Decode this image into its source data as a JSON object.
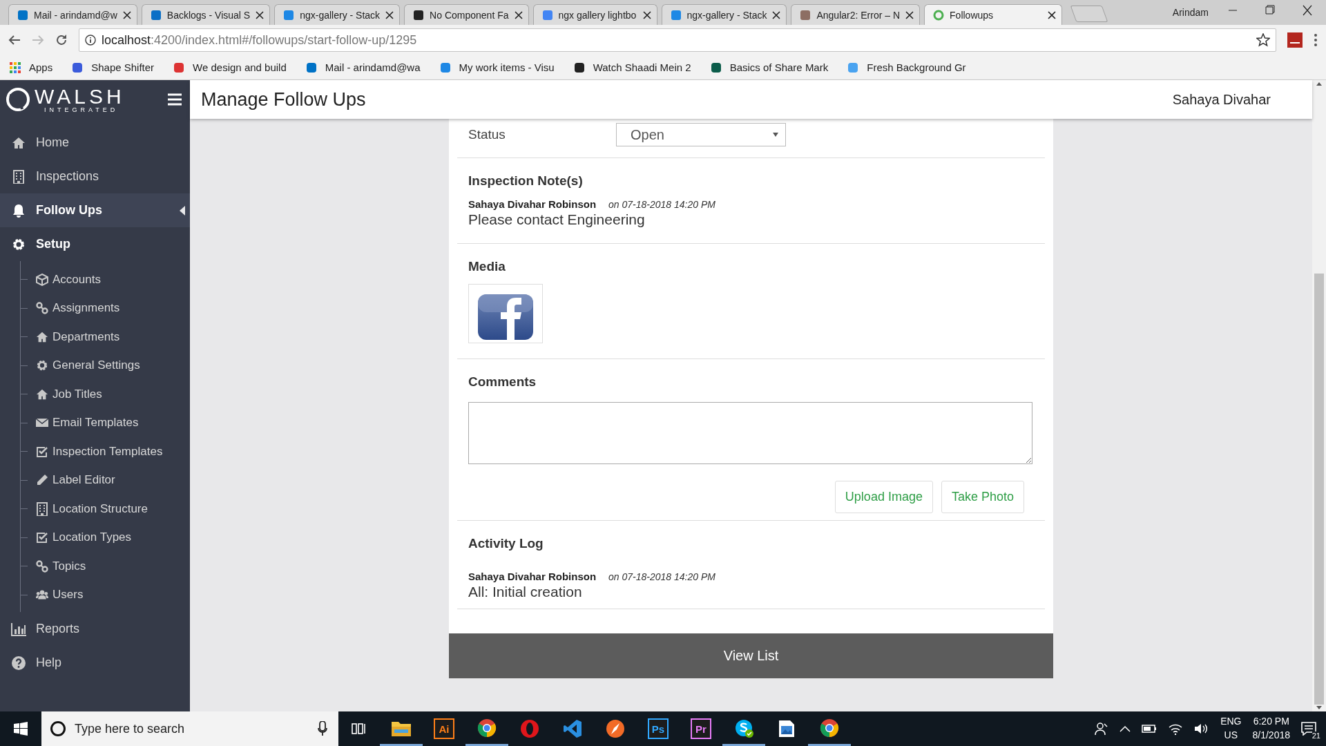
{
  "browser": {
    "tabs": [
      {
        "title": "Mail - arindamd@w",
        "selected": false
      },
      {
        "title": "Backlogs - Visual S",
        "selected": false
      },
      {
        "title": "ngx-gallery - Stack",
        "selected": false
      },
      {
        "title": "No Component Fa",
        "selected": false
      },
      {
        "title": "ngx gallery lightbo",
        "selected": false
      },
      {
        "title": "ngx-gallery - Stack",
        "selected": false
      },
      {
        "title": "Angular2: Error – N",
        "selected": false
      },
      {
        "title": "Followups",
        "selected": true
      }
    ],
    "profile": "Arindam",
    "url_host": "localhost",
    "url_path": ":4200/index.html#/followups/start-follow-up/1295",
    "bookmarks": [
      "Apps",
      "Shape Shifter",
      "We design and build",
      "Mail - arindamd@wa",
      "My work items - Visu",
      "Watch Shaadi Mein 2",
      "Basics of Share Mark",
      "Fresh Background Gr"
    ]
  },
  "sidebar": {
    "logo": "WALSH",
    "logo_sub": "INTEGRATED",
    "items": [
      {
        "label": "Home",
        "selected": false
      },
      {
        "label": "Inspections",
        "selected": false
      },
      {
        "label": "Follow Ups",
        "selected": true
      },
      {
        "label": "Setup",
        "selected": false,
        "expanded": true,
        "children": [
          {
            "label": "Accounts"
          },
          {
            "label": "Assignments"
          },
          {
            "label": "Departments"
          },
          {
            "label": "General Settings"
          },
          {
            "label": "Job Titles"
          },
          {
            "label": "Email Templates"
          },
          {
            "label": "Inspection Templates"
          },
          {
            "label": "Label Editor"
          },
          {
            "label": "Location Structure"
          },
          {
            "label": "Location Types"
          },
          {
            "label": "Topics"
          },
          {
            "label": "Users"
          }
        ]
      },
      {
        "label": "Reports",
        "selected": false
      },
      {
        "label": "Help",
        "selected": false
      }
    ]
  },
  "header": {
    "title": "Manage Follow Ups",
    "user": "Sahaya Divahar"
  },
  "form": {
    "status": {
      "label": "Status",
      "value": "Open"
    },
    "notes": {
      "heading": "Inspection Note(s)",
      "entries": [
        {
          "author": "Sahaya Divahar Robinson",
          "date": "on 07-18-2018 14:20 PM",
          "text": "Please contact Engineering"
        }
      ]
    },
    "media": {
      "heading": "Media"
    },
    "comments": {
      "heading": "Comments"
    },
    "buttons": [
      "Upload Image",
      "Take Photo"
    ],
    "activity": {
      "heading": "Activity Log",
      "entries": [
        {
          "author": "Sahaya Divahar Robinson",
          "date": "on 07-18-2018 14:20 PM",
          "text": "All: Initial creation"
        }
      ]
    },
    "view_list": "View List"
  },
  "taskbar": {
    "search_placeholder": "Type here to search",
    "apps": [
      {
        "kind": "explorer",
        "running": true
      },
      {
        "kind": "badge",
        "label": "Ai",
        "color": "#ff7f18",
        "running": false
      },
      {
        "kind": "chrome",
        "running": true
      },
      {
        "kind": "opera",
        "running": false
      },
      {
        "kind": "code",
        "running": false
      },
      {
        "kind": "swift",
        "running": false
      },
      {
        "kind": "badge",
        "label": "Ps",
        "color": "#31a8ff",
        "running": false
      },
      {
        "kind": "badge",
        "label": "Pr",
        "color": "#e77cf7",
        "running": false
      },
      {
        "kind": "skype",
        "running": true
      },
      {
        "kind": "photos",
        "running": false
      },
      {
        "kind": "chrome",
        "running": true
      }
    ],
    "lang": "ENG",
    "region": "US",
    "time": "6:20 PM",
    "date": "8/1/2018",
    "notifications": "21"
  }
}
